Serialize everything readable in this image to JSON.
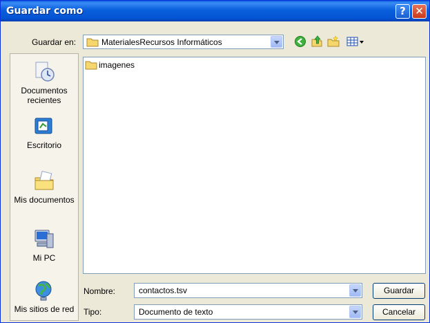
{
  "window": {
    "title": "Guardar como"
  },
  "toolbar": {
    "save_in_label": "Guardar en:",
    "save_in_value": "MaterialesRecursos Informáticos"
  },
  "places": [
    {
      "label": "Documentos recientes",
      "icon": "recent-documents-icon"
    },
    {
      "label": "Escritorio",
      "icon": "desktop-icon"
    },
    {
      "label": "Mis documentos",
      "icon": "my-documents-icon"
    },
    {
      "label": "Mi PC",
      "icon": "my-computer-icon"
    },
    {
      "label": "Mis sitios de red",
      "icon": "network-places-icon"
    }
  ],
  "files": [
    {
      "name": "imagenes",
      "icon": "folder-icon"
    }
  ],
  "form": {
    "name_label": "Nombre:",
    "name_value": "contactos.tsv",
    "type_label": "Tipo:",
    "type_value": "Documento de texto"
  },
  "buttons": {
    "save": "Guardar",
    "cancel": "Cancelar"
  },
  "colors": {
    "titlebar": "#0a5fdc",
    "close": "#c8391a",
    "folder": "#f5d76e"
  }
}
